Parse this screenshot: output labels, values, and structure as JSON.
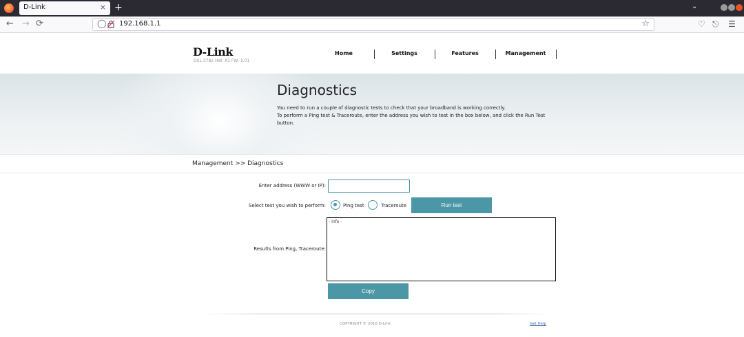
{
  "browser": {
    "tab_title": "D-Link",
    "tab_close": "×",
    "new_tab": "+",
    "url": "192.168.1.1",
    "back": "←",
    "forward": "→",
    "reload": "⟳",
    "bookmark": "☆"
  },
  "header": {
    "logo": "D-Link",
    "model_info": "DSL-3782  HW: A1  FW: 1.01",
    "menu": [
      "Home",
      "Settings",
      "Features",
      "Management"
    ]
  },
  "banner": {
    "title": "Diagnostics",
    "line1": "You need to run a couple of diagnostic tests to check that your broadband is working correctly.",
    "line2": "To perform a Ping test & Traceroute, enter the address you wish to test in the box below, and click the Run Test button."
  },
  "breadcrumb": "Management >> Diagnostics",
  "form": {
    "address_label": "Enter address (WWW or IP):",
    "address_value": "",
    "test_label": "Select test you wish to perform:",
    "ping_label": "Ping test",
    "traceroute_label": "Traceroute",
    "selected_test": "Ping test",
    "run_button": "Run test",
    "results_label": "Results from Ping, Traceroute:",
    "results_text": "- Info -",
    "copy_button": "Copy"
  },
  "footer": {
    "copyright": "COPYRIGHT © 2016 D-Link",
    "help": "Get Help"
  },
  "colors": {
    "accent": "#4b97a6",
    "tabbar": "#2b2a33"
  }
}
